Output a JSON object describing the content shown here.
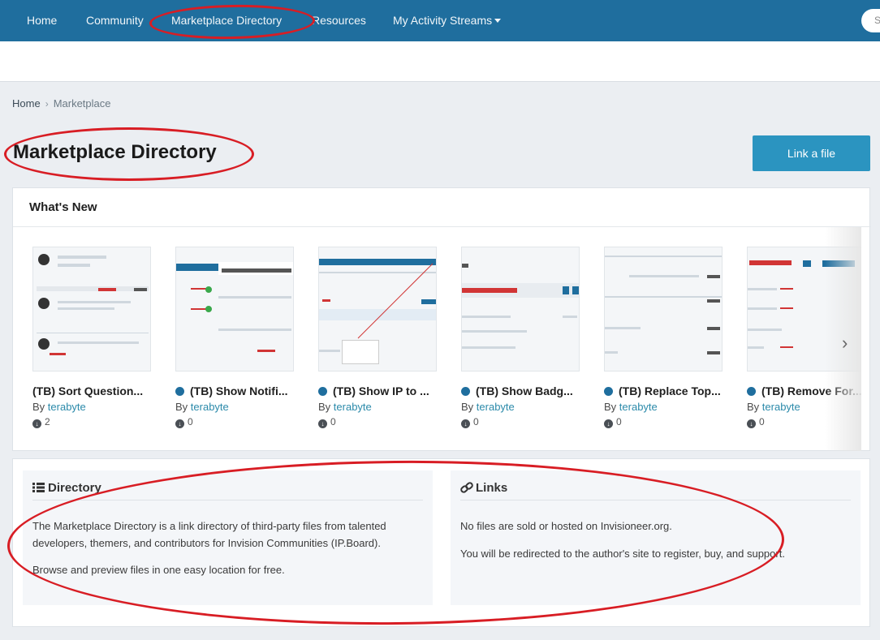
{
  "nav": {
    "items": [
      {
        "label": "Home"
      },
      {
        "label": "Community"
      },
      {
        "label": "Marketplace Directory"
      },
      {
        "label": "Resources"
      },
      {
        "label": "My Activity Streams"
      }
    ],
    "search_placeholder": "S"
  },
  "breadcrumb": {
    "home": "Home",
    "current": "Marketplace"
  },
  "page": {
    "title": "Marketplace Directory",
    "link_button": "Link a file"
  },
  "whats_new": {
    "title": "What's New",
    "cards": [
      {
        "title": "(TB) Sort Question...",
        "by": "By",
        "author": "terabyte",
        "downloads": "2",
        "dot": false
      },
      {
        "title": "(TB) Show Notifi...",
        "by": "By",
        "author": "terabyte",
        "downloads": "0",
        "dot": true
      },
      {
        "title": "(TB) Show IP to ...",
        "by": "By",
        "author": "terabyte",
        "downloads": "0",
        "dot": true
      },
      {
        "title": "(TB) Show Badg...",
        "by": "By",
        "author": "terabyte",
        "downloads": "0",
        "dot": true
      },
      {
        "title": "(TB) Replace Top...",
        "by": "By",
        "author": "terabyte",
        "downloads": "0",
        "dot": true
      },
      {
        "title": "(TB) Remove For...",
        "by": "By",
        "author": "terabyte",
        "downloads": "0",
        "dot": true
      }
    ]
  },
  "directory": {
    "heading": "Directory",
    "paragraph1": "The Marketplace Directory is a link directory of third-party files from talented developers, themers, and contributors for Invision Communities (IP.Board).",
    "paragraph2": "Browse and preview files in one easy location for free."
  },
  "links": {
    "heading": "Links",
    "paragraph1": "No files are sold or hosted on Invisioneer.org.",
    "paragraph2": "You will be redirected to the author's site to register, buy, and support."
  },
  "colors": {
    "nav_bg": "#1f6e9e",
    "accent_button": "#2b94c0",
    "author_link": "#2b8aaa",
    "annotation_red": "#d81d24"
  }
}
